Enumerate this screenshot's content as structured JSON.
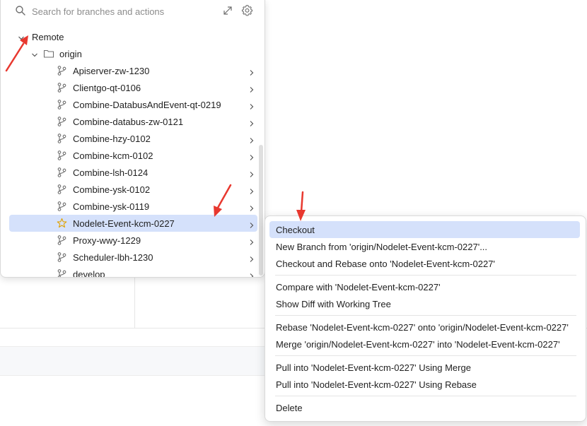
{
  "search": {
    "placeholder": "Search for branches and actions"
  },
  "icons": {
    "search": "search-icon",
    "collapse": "collapse-arrows-icon",
    "settings": "gear-icon",
    "chevron_down": "chevron-down-icon",
    "folder": "folder-icon",
    "branch": "branch-icon",
    "star": "star-icon",
    "chevron_right": "chevron-right-icon"
  },
  "tree": {
    "remote_label": "Remote",
    "origin_label": "origin",
    "branches": [
      {
        "label": "Apiserver-zw-1230",
        "selected": false
      },
      {
        "label": "Clientgo-qt-0106",
        "selected": false
      },
      {
        "label": "Combine-DatabusAndEvent-qt-0219",
        "selected": false
      },
      {
        "label": "Combine-databus-zw-0121",
        "selected": false
      },
      {
        "label": "Combine-hzy-0102",
        "selected": false
      },
      {
        "label": "Combine-kcm-0102",
        "selected": false
      },
      {
        "label": "Combine-lsh-0124",
        "selected": false
      },
      {
        "label": "Combine-ysk-0102",
        "selected": false
      },
      {
        "label": "Combine-ysk-0119",
        "selected": false
      },
      {
        "label": "Nodelet-Event-kcm-0227",
        "selected": true
      },
      {
        "label": "Proxy-wwy-1229",
        "selected": false
      },
      {
        "label": "Scheduler-lbh-1230",
        "selected": false
      },
      {
        "label": "develop",
        "selected": false
      }
    ]
  },
  "context_menu": {
    "groups": [
      [
        {
          "label": "Checkout",
          "highlighted": true
        },
        {
          "label": "New Branch from 'origin/Nodelet-Event-kcm-0227'...",
          "highlighted": false
        },
        {
          "label": "Checkout and Rebase onto 'Nodelet-Event-kcm-0227'",
          "highlighted": false
        }
      ],
      [
        {
          "label": "Compare with 'Nodelet-Event-kcm-0227'",
          "highlighted": false
        },
        {
          "label": "Show Diff with Working Tree",
          "highlighted": false
        }
      ],
      [
        {
          "label": "Rebase 'Nodelet-Event-kcm-0227' onto 'origin/Nodelet-Event-kcm-0227'",
          "highlighted": false
        },
        {
          "label": "Merge 'origin/Nodelet-Event-kcm-0227' into 'Nodelet-Event-kcm-0227'",
          "highlighted": false
        }
      ],
      [
        {
          "label": "Pull into 'Nodelet-Event-kcm-0227' Using Merge",
          "highlighted": false
        },
        {
          "label": "Pull into 'Nodelet-Event-kcm-0227' Using Rebase",
          "highlighted": false
        }
      ],
      [
        {
          "label": "Delete",
          "highlighted": false
        }
      ]
    ]
  },
  "colors": {
    "selection": "#d5e1fb",
    "annotation_arrow": "#e8382f",
    "icon_gray": "#6e6e6e",
    "star": "#e0a100"
  }
}
